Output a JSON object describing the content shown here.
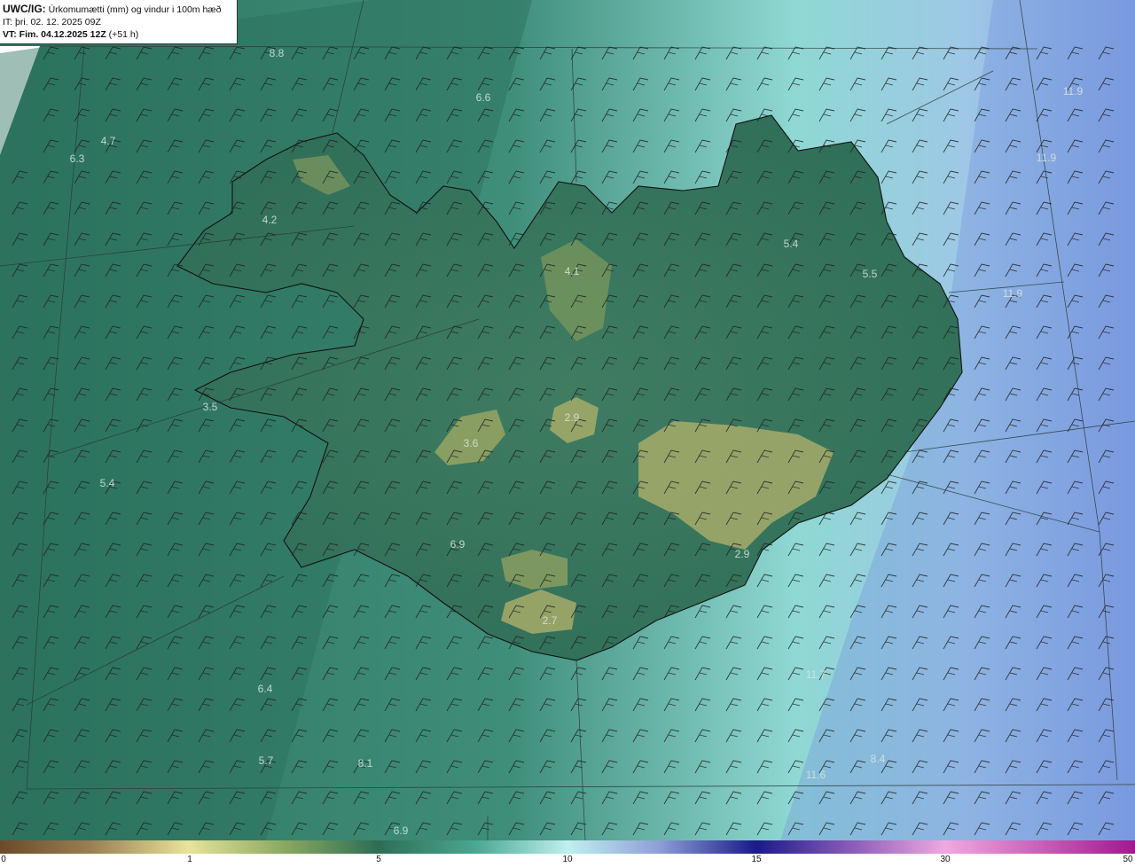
{
  "header": {
    "model": "UWC/IG:",
    "title": "Úrkomumætti (mm) og vindur i 100m hæð",
    "issue_time": "IT: þri. 02. 12. 2025 09Z",
    "valid_label": "VT:",
    "valid_time": "Fim. 04.12.2025 12Z",
    "lead": "(+51 h)"
  },
  "map_labels": [
    {
      "text": "8.8"
    },
    {
      "text": "6.6"
    },
    {
      "text": "4.7"
    },
    {
      "text": "6.3"
    },
    {
      "text": "4.2"
    },
    {
      "text": "4.1"
    },
    {
      "text": "5.4"
    },
    {
      "text": "5.5"
    },
    {
      "text": "11.9"
    },
    {
      "text": "11.9"
    },
    {
      "text": "11.9"
    },
    {
      "text": "3.5"
    },
    {
      "text": "2.9"
    },
    {
      "text": "3.6"
    },
    {
      "text": "5.4"
    },
    {
      "text": "6.9"
    },
    {
      "text": "2.9"
    },
    {
      "text": "2.7"
    },
    {
      "text": "6.4"
    },
    {
      "text": "5.7"
    },
    {
      "text": "8.1"
    },
    {
      "text": "6.9"
    },
    {
      "text": "11.6"
    },
    {
      "text": "8.4"
    },
    {
      "text": "11.7"
    }
  ],
  "colorbar": {
    "ticks": [
      "0",
      "1",
      "5",
      "10",
      "15",
      "30",
      "50"
    ],
    "colors": [
      "#6b4a2a",
      "#b5a36a",
      "#e8e39a",
      "#6e9a55",
      "#2d6e55",
      "#4aa892",
      "#bff0ee",
      "#8ea0d8",
      "#1a1a8a",
      "#b070c8",
      "#f0a8e0",
      "#a01890"
    ]
  },
  "legend": {
    "colors_note": "precipitation shading"
  }
}
